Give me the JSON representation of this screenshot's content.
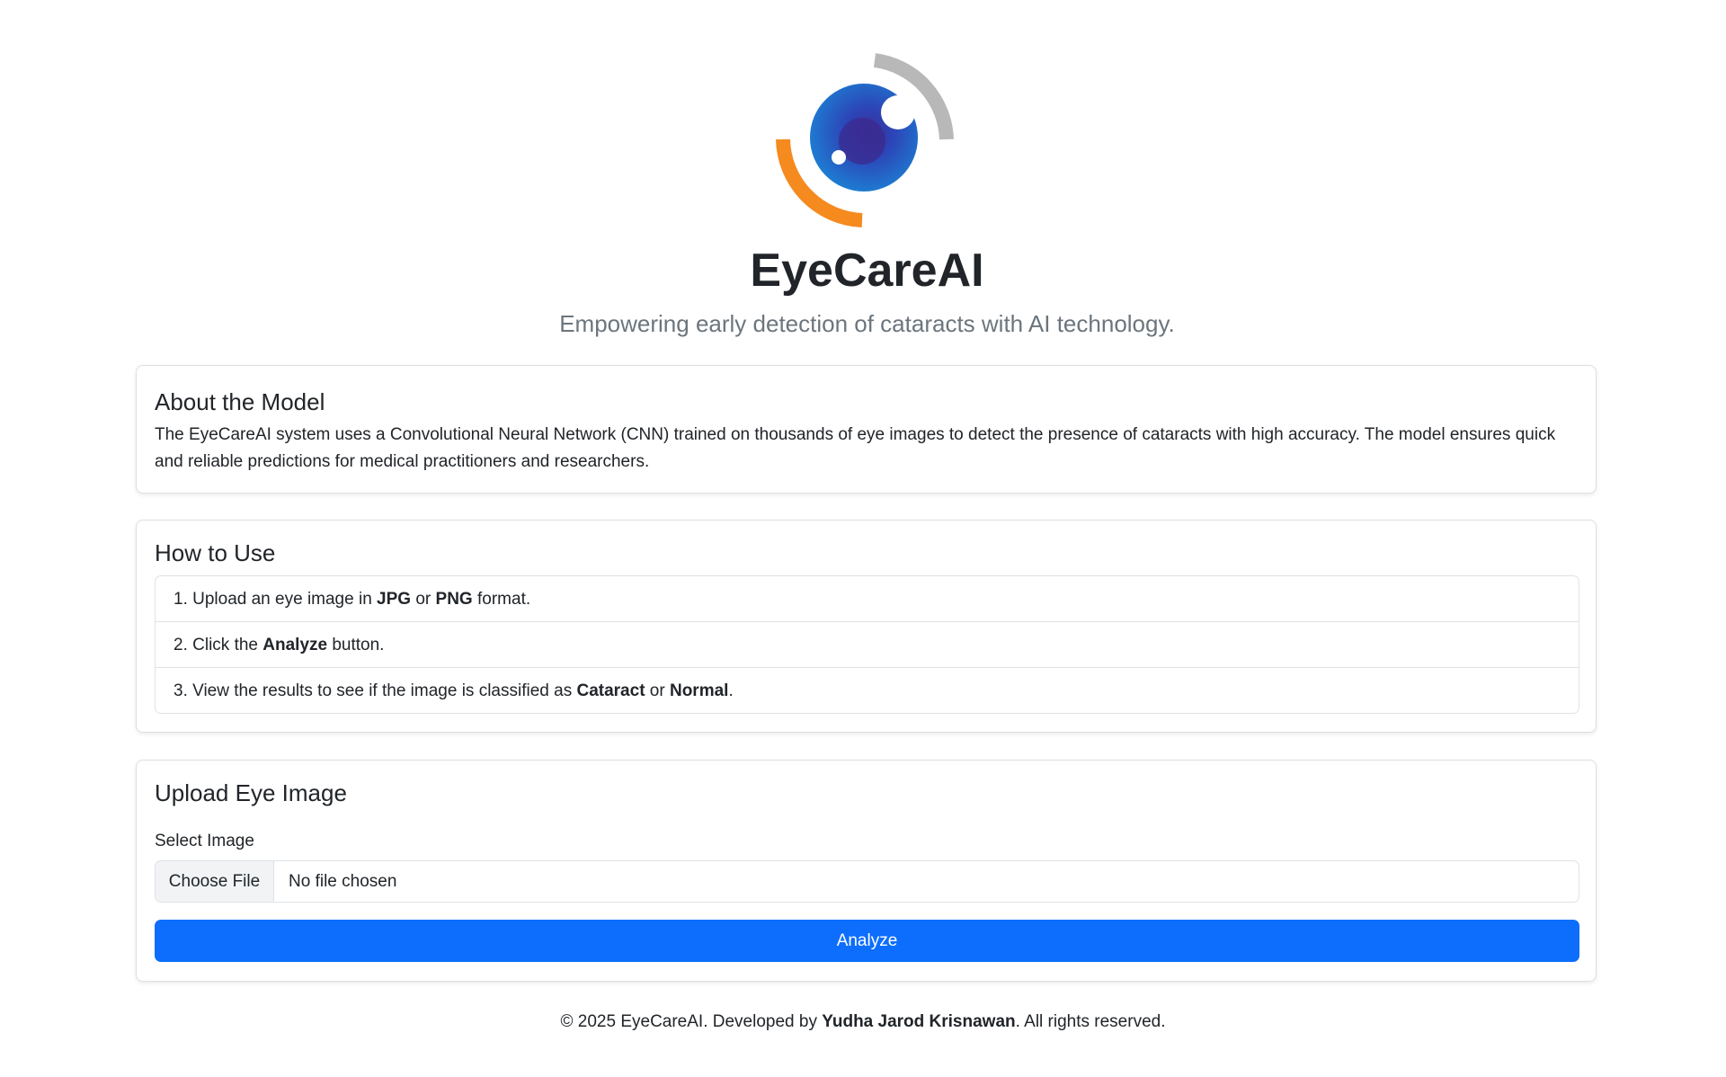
{
  "header": {
    "logo": "eye-logo",
    "title": "EyeCareAI",
    "tagline": "Empowering early detection of cataracts with AI technology."
  },
  "about": {
    "title": "About the Model",
    "text": "The EyeCareAI system uses a Convolutional Neural Network (CNN) trained on thousands of eye images to detect the presence of cataracts with high accuracy. The model ensures quick and reliable predictions for medical practitioners and researchers."
  },
  "how_to_use": {
    "title": "How to Use",
    "steps": [
      {
        "prefix": "1. Upload an eye image in ",
        "b1": "JPG",
        "mid": " or ",
        "b2": "PNG",
        "suffix": " format."
      },
      {
        "prefix": "2. Click the ",
        "b1": "Analyze",
        "mid": "",
        "b2": "",
        "suffix": " button."
      },
      {
        "prefix": "3. View the results to see if the image is classified as ",
        "b1": "Cataract",
        "mid": " or ",
        "b2": "Normal",
        "suffix": "."
      }
    ]
  },
  "upload": {
    "title": "Upload Eye Image",
    "label": "Select Image",
    "choose_file": "Choose File",
    "no_file": "No file chosen",
    "analyze_label": "Analyze"
  },
  "footer": {
    "prefix": "© 2025 EyeCareAI. Developed by ",
    "author": "Yudha Jarod Krisnawan",
    "suffix": ". All rights reserved."
  },
  "colors": {
    "primary": "#0d6efd",
    "logo_orange": "#f58a1f",
    "logo_gray": "#b8b8b8",
    "logo_blue": "#2a59c7"
  }
}
